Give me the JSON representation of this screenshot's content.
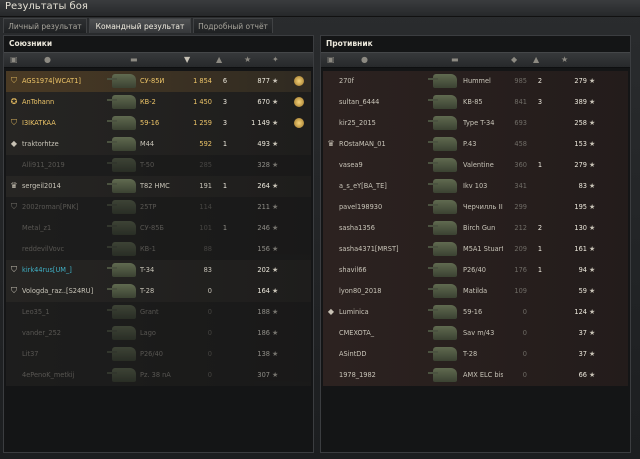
{
  "window": {
    "title": "Результаты боя"
  },
  "tabs": [
    {
      "label": "Личный результат",
      "active": false
    },
    {
      "label": "Командный результат",
      "active": true
    },
    {
      "label": "Подробный отчёт",
      "active": false
    }
  ],
  "columns": [
    "badge-icon",
    "player-icon",
    "tank-icon",
    "damage-icon",
    "kills-icon",
    "xp-star-icon"
  ],
  "allies": {
    "title": "Союзники",
    "rows": [
      {
        "badge": "shield-icon",
        "player": "AGS1974[WCAT1]",
        "tank": "СУ-85И",
        "damage": "1 854",
        "kills": "6",
        "xp": "877",
        "medal": true,
        "style": "gold",
        "first": true,
        "dead": false
      },
      {
        "badge": "star-badge-icon",
        "player": "AnTohann",
        "tank": "КВ-2",
        "damage": "1 450",
        "kills": "3",
        "xp": "670",
        "medal": true,
        "style": "gold",
        "first": false,
        "dead": false
      },
      {
        "badge": "shield-icon",
        "player": "I3IKATKAA",
        "tank": "59-16",
        "damage": "1 259",
        "kills": "3",
        "xp": "1 149",
        "medal": true,
        "style": "gold",
        "first": false,
        "dead": false
      },
      {
        "badge": "diamond-icon",
        "player": "traktorhtze",
        "tank": "M44",
        "damage": "592",
        "kills": "1",
        "xp": "493",
        "medal": false,
        "style": "gold-dmg",
        "first": false,
        "dead": false
      },
      {
        "badge": "",
        "player": "Alli911_2019",
        "tank": "T-50",
        "damage": "285",
        "kills": "",
        "xp": "328",
        "medal": false,
        "style": "dim",
        "first": false,
        "dead": true
      },
      {
        "badge": "crown-icon",
        "player": "sergeil2014",
        "tank": "T82 HMC",
        "damage": "191",
        "kills": "1",
        "xp": "264",
        "medal": false,
        "style": "normal",
        "first": false,
        "dead": false
      },
      {
        "badge": "shield-icon",
        "player": "2002roman[PNK]",
        "tank": "25TP",
        "damage": "114",
        "kills": "",
        "xp": "211",
        "medal": false,
        "style": "dim",
        "first": false,
        "dead": true
      },
      {
        "badge": "",
        "player": "Metal_z1",
        "tank": "СУ-85Б",
        "damage": "101",
        "kills": "1",
        "xp": "246",
        "medal": false,
        "style": "dim",
        "first": false,
        "dead": true
      },
      {
        "badge": "",
        "player": "reddevilVovc",
        "tank": "КВ-1",
        "damage": "88",
        "kills": "",
        "xp": "156",
        "medal": false,
        "style": "dim",
        "first": false,
        "dead": true
      },
      {
        "badge": "shield-icon",
        "player": "kirk44rus[UM_]",
        "tank": "T-34",
        "damage": "83",
        "kills": "",
        "xp": "202",
        "medal": false,
        "style": "teal",
        "first": false,
        "dead": false
      },
      {
        "badge": "shield-icon",
        "player": "Vologda_raz..[S24RU]",
        "tank": "T-28",
        "damage": "0",
        "kills": "",
        "xp": "164",
        "medal": false,
        "style": "normal",
        "first": false,
        "dead": false
      },
      {
        "badge": "",
        "player": "Leo35_1",
        "tank": "Grant",
        "damage": "0",
        "kills": "",
        "xp": "188",
        "medal": false,
        "style": "dim",
        "first": false,
        "dead": true
      },
      {
        "badge": "",
        "player": "vander_252",
        "tank": "Lago",
        "damage": "0",
        "kills": "",
        "xp": "186",
        "medal": false,
        "style": "dim",
        "first": false,
        "dead": true
      },
      {
        "badge": "",
        "player": "Lit37",
        "tank": "P26/40",
        "damage": "0",
        "kills": "",
        "xp": "138",
        "medal": false,
        "style": "dim",
        "first": false,
        "dead": true
      },
      {
        "badge": "",
        "player": "4ePenoK_metkij",
        "tank": "Pz. 38 nA",
        "damage": "0",
        "kills": "",
        "xp": "307",
        "medal": false,
        "style": "dim",
        "first": false,
        "dead": true
      }
    ]
  },
  "enemies": {
    "title": "Противник",
    "rows": [
      {
        "badge": "",
        "player": "270f",
        "tank": "Hummel",
        "damage": "985",
        "kills": "2",
        "xp": "279"
      },
      {
        "badge": "",
        "player": "sultan_6444",
        "tank": "KB-85",
        "damage": "841",
        "kills": "3",
        "xp": "389"
      },
      {
        "badge": "",
        "player": "kir25_2015",
        "tank": "Type T-34",
        "damage": "693",
        "kills": "",
        "xp": "258"
      },
      {
        "badge": "crown-icon",
        "player": "ROstaMAN_01",
        "tank": "P.43",
        "damage": "458",
        "kills": "",
        "xp": "153"
      },
      {
        "badge": "",
        "player": "vasea9",
        "tank": "Valentine",
        "damage": "360",
        "kills": "1",
        "xp": "279"
      },
      {
        "badge": "",
        "player": "a_s_eY[BA_TE]",
        "tank": "Ikv 103",
        "damage": "341",
        "kills": "",
        "xp": "83"
      },
      {
        "badge": "",
        "player": "pavel198930",
        "tank": "Черчилль III",
        "damage": "299",
        "kills": "",
        "xp": "195"
      },
      {
        "badge": "",
        "player": "sasha1356",
        "tank": "Birch Gun",
        "damage": "212",
        "kills": "2",
        "xp": "130"
      },
      {
        "badge": "",
        "player": "sasha4371[MRST]",
        "tank": "M5A1 Stuart",
        "damage": "209",
        "kills": "1",
        "xp": "161"
      },
      {
        "badge": "",
        "player": "shavil66",
        "tank": "P26/40",
        "damage": "176",
        "kills": "1",
        "xp": "94"
      },
      {
        "badge": "",
        "player": "lyon80_2018",
        "tank": "Matilda",
        "damage": "109",
        "kills": "",
        "xp": "59"
      },
      {
        "badge": "diamond-icon",
        "player": "Luminica",
        "tank": "59-16",
        "damage": "0",
        "kills": "",
        "xp": "124"
      },
      {
        "badge": "",
        "player": "CMEXOTA_",
        "tank": "Sav m/43",
        "damage": "0",
        "kills": "",
        "xp": "37"
      },
      {
        "badge": "",
        "player": "ASintDD",
        "tank": "T-28",
        "damage": "0",
        "kills": "",
        "xp": "37"
      },
      {
        "badge": "",
        "player": "1978_1982",
        "tank": "AMX ELC bis",
        "damage": "0",
        "kills": "",
        "xp": "66"
      }
    ]
  }
}
